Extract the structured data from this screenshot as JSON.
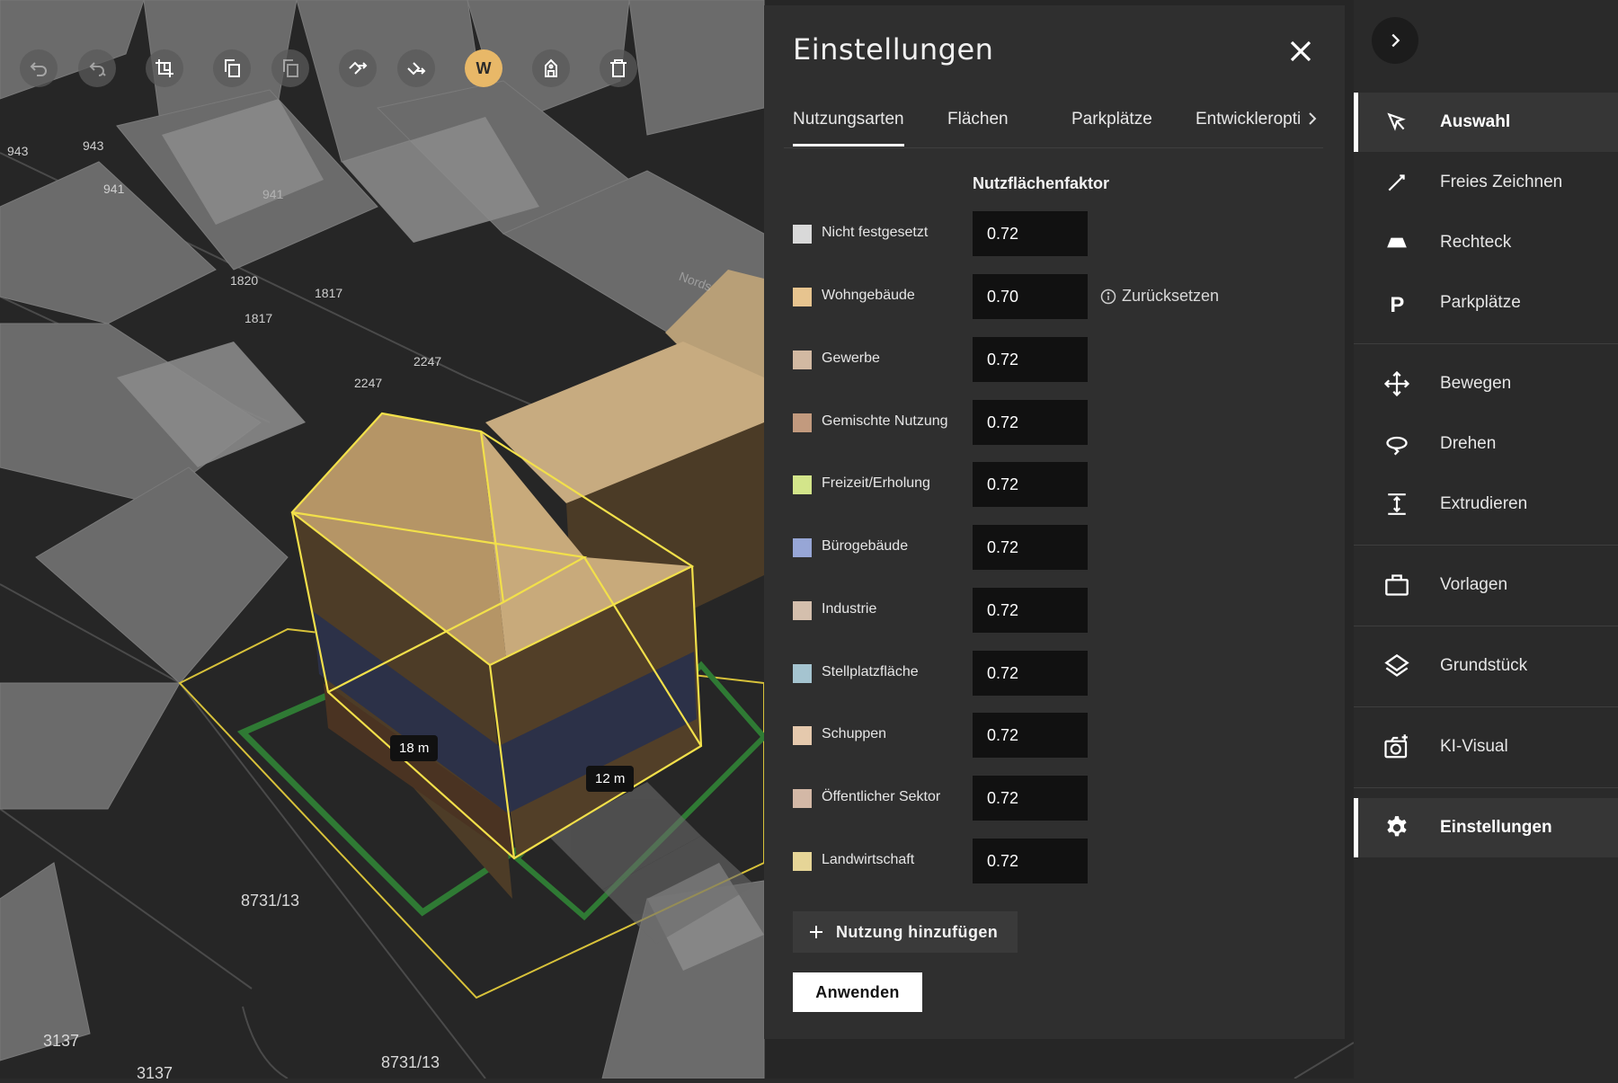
{
  "toolbar": {
    "user_initial": "W",
    "buttons": [
      "undo-icon",
      "redo-icon",
      "crop-icon",
      "copy-icon",
      "paste-icon",
      "move-up-icon",
      "move-down-icon",
      "user-avatar",
      "building-icon",
      "trash-icon"
    ]
  },
  "map": {
    "plot_labels": [
      "943",
      "941",
      "941",
      "1820",
      "1817",
      "1817",
      "2247",
      "2247",
      "8731/13",
      "8731/13",
      "3137",
      "3137",
      "Nords"
    ],
    "dimension_a": "18 m",
    "dimension_b": "12 m"
  },
  "panel": {
    "title": "Einstellungen",
    "tabs": [
      {
        "label": "Nutzungsarten"
      },
      {
        "label": "Flächen"
      },
      {
        "label": "Parkplätze"
      },
      {
        "label": "Entwickleropti"
      }
    ],
    "column_header": "Nutzflächenfaktor",
    "reset_label": "Zurücksetzen",
    "rows": [
      {
        "label": "Nicht festgesetzt",
        "value": "0.72",
        "color": "#d9d9d9"
      },
      {
        "label": "Wohngebäude",
        "value": "0.70",
        "color": "#e7c48f"
      },
      {
        "label": "Gewerbe",
        "value": "0.72",
        "color": "#d2b9a2"
      },
      {
        "label": "Gemischte Nutzung",
        "value": "0.72",
        "color": "#c29a7e"
      },
      {
        "label": "Freizeit/Erholung",
        "value": "0.72",
        "color": "#d3e58a"
      },
      {
        "label": "Bürogebäude",
        "value": "0.72",
        "color": "#97a6d6"
      },
      {
        "label": "Industrie",
        "value": "0.72",
        "color": "#d4bfad"
      },
      {
        "label": "Stellplatzfläche",
        "value": "0.72",
        "color": "#a5c4d0"
      },
      {
        "label": "Schuppen",
        "value": "0.72",
        "color": "#e5c9ad"
      },
      {
        "label": "Öffentlicher Sektor",
        "value": "0.72",
        "color": "#d3b8a6"
      },
      {
        "label": "Landwirtschaft",
        "value": "0.72",
        "color": "#e6d597"
      }
    ],
    "add_label": "Nutzung hinzufügen",
    "apply_label": "Anwenden"
  },
  "sidebar": {
    "items": [
      {
        "label": "Auswahl",
        "icon": "cursor-icon"
      },
      {
        "label": "Freies Zeichnen",
        "icon": "pen-icon"
      },
      {
        "label": "Rechteck",
        "icon": "rectangle-icon"
      },
      {
        "label": "Parkplätze",
        "icon": "parking-icon"
      },
      {
        "label": "Bewegen",
        "icon": "move-icon"
      },
      {
        "label": "Drehen",
        "icon": "rotate-icon"
      },
      {
        "label": "Extrudieren",
        "icon": "extrude-icon"
      },
      {
        "label": "Vorlagen",
        "icon": "briefcase-icon"
      },
      {
        "label": "Grundstück",
        "icon": "layers-icon"
      },
      {
        "label": "KI-Visual",
        "icon": "ai-camera-icon"
      },
      {
        "label": "Einstellungen",
        "icon": "gear-icon"
      }
    ]
  }
}
